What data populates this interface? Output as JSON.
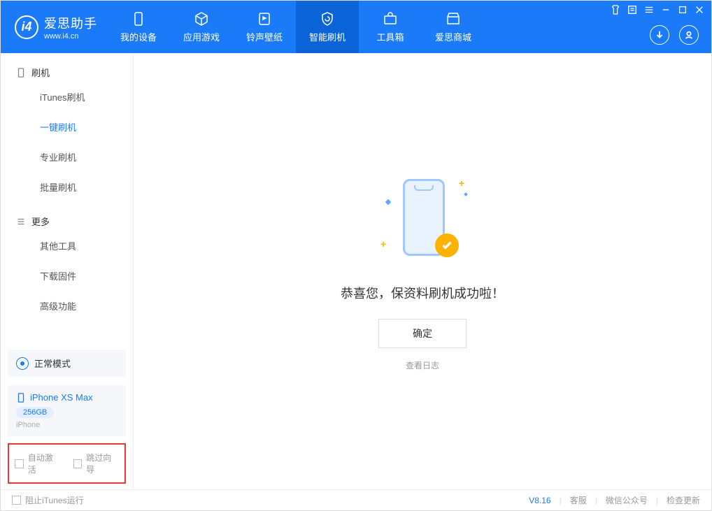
{
  "app": {
    "title": "爱思助手",
    "subtitle": "www.i4.cn"
  },
  "nav": {
    "items": [
      {
        "label": "我的设备"
      },
      {
        "label": "应用游戏"
      },
      {
        "label": "铃声壁纸"
      },
      {
        "label": "智能刷机"
      },
      {
        "label": "工具箱"
      },
      {
        "label": "爱思商城"
      }
    ]
  },
  "sidebar": {
    "group1": {
      "title": "刷机"
    },
    "items1": [
      {
        "label": "iTunes刷机"
      },
      {
        "label": "一键刷机"
      },
      {
        "label": "专业刷机"
      },
      {
        "label": "批量刷机"
      }
    ],
    "group2": {
      "title": "更多"
    },
    "items2": [
      {
        "label": "其他工具"
      },
      {
        "label": "下载固件"
      },
      {
        "label": "高级功能"
      }
    ],
    "mode_label": "正常模式",
    "device": {
      "name": "iPhone XS Max",
      "capacity": "256GB",
      "type": "iPhone"
    },
    "options": {
      "auto_activate": "自动激活",
      "skip_guide": "跳过向导"
    }
  },
  "main": {
    "success_text": "恭喜您，保资料刷机成功啦！",
    "ok_label": "确定",
    "log_label": "查看日志"
  },
  "footer": {
    "block_itunes": "阻止iTunes运行",
    "version": "V8.16",
    "support": "客服",
    "wechat": "微信公众号",
    "check_update": "检查更新"
  }
}
